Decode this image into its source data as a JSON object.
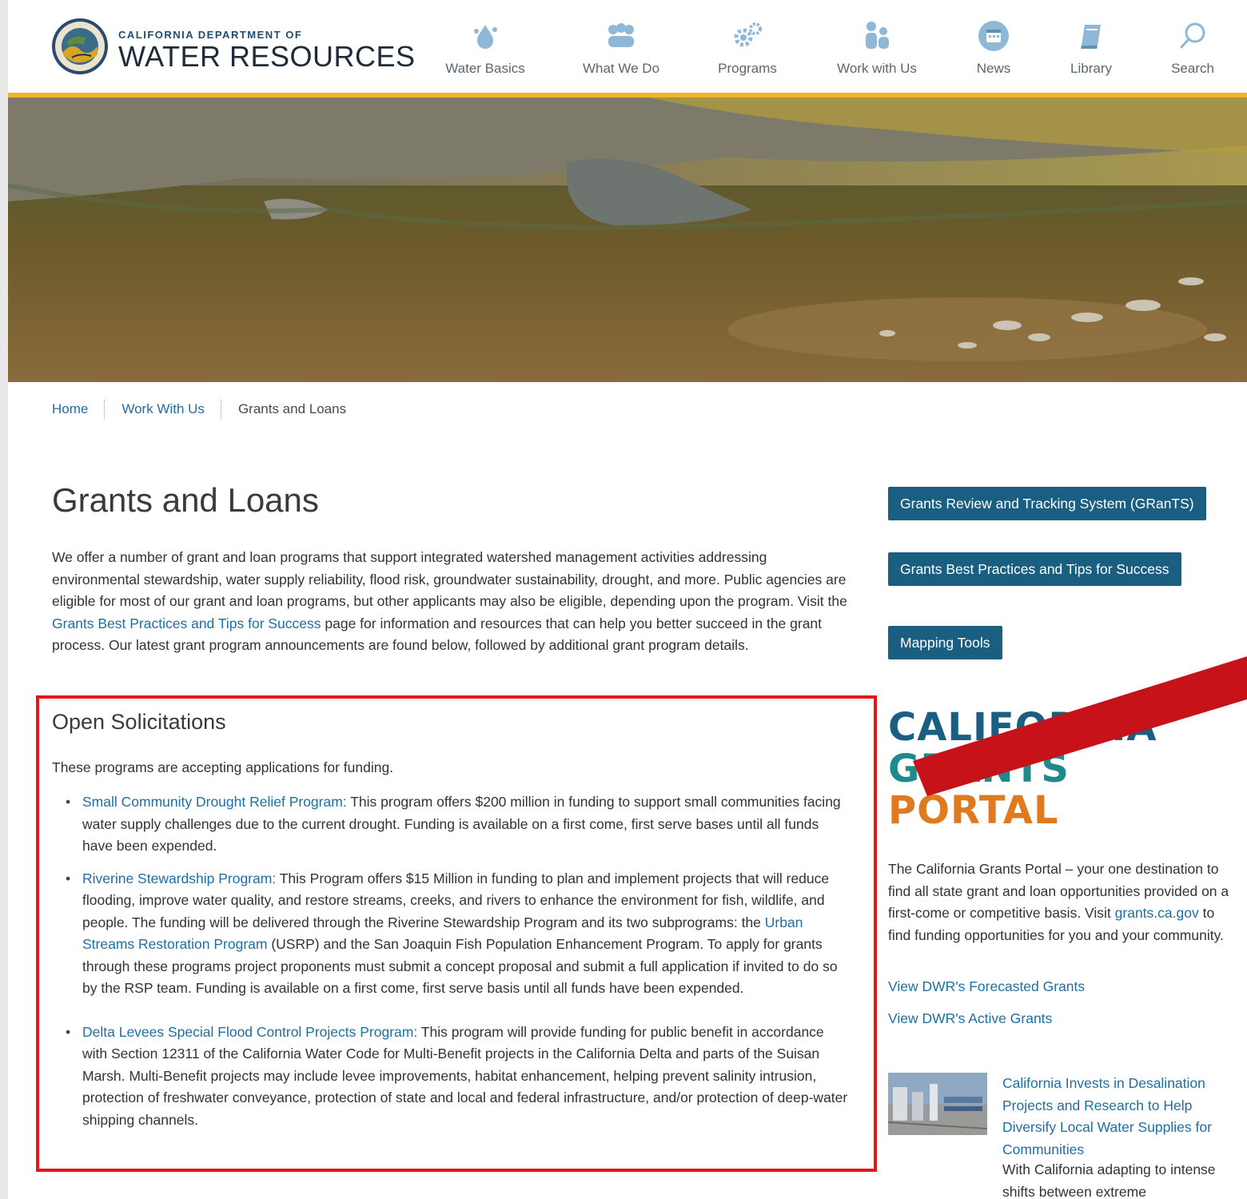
{
  "header": {
    "agency_top": "CALIFORNIA DEPARTMENT OF",
    "agency_main": "WATER RESOURCES",
    "nav": [
      {
        "label": "Water Basics",
        "icon": "water-drops-icon"
      },
      {
        "label": "What We Do",
        "icon": "people-group-icon"
      },
      {
        "label": "Programs",
        "icon": "gears-icon"
      },
      {
        "label": "Work with Us",
        "icon": "work-people-icon"
      },
      {
        "label": "News",
        "icon": "calendar-icon"
      },
      {
        "label": "Library",
        "icon": "book-icon"
      },
      {
        "label": "Search",
        "icon": "search-icon"
      }
    ]
  },
  "breadcrumb": {
    "home": "Home",
    "parent": "Work With Us",
    "current": "Grants and Loans"
  },
  "main": {
    "title": "Grants and Loans",
    "intro_part1": "We offer a number of grant and loan programs that support integrated watershed management activities addressing environmental stewardship, water supply reliability, flood risk, groundwater sustainability, drought, and more. Public agencies are eligible for most of our grant and loan programs, but other applicants may also be eligible, depending upon the program.  Visit the ",
    "intro_link": "Grants Best Practices and Tips for Success",
    "intro_part2": " page for information and resources that can help you better succeed in the grant process. Our latest grant program announcements are found below, followed by additional grant program details.",
    "open_solicitations": {
      "title": "Open Solicitations",
      "subtitle": "These programs are accepting applications for funding.",
      "item1_link": "Small Community Drought Relief Program:",
      "item1_text": " This program offers $200 million in funding to support small communities facing water supply challenges due to the current drought. Funding is available on a first come, first serve bases until all funds have been expended.",
      "item2_link": "Riverine Stewardship Program:",
      "item2_text_a": " This Program offers $15 Million in funding to plan and implement projects that will reduce flooding, improve water quality, and restore streams, creeks, and rivers to enhance the environment for fish, wildlife, and people. The funding will be delivered through the Riverine Stewardship Program and its two subprograms: the ",
      "item2_link2": "Urban Streams Restoration Program",
      "item2_text_b": " (USRP) and the San Joaquin Fish Population Enhancement Program. To apply for grants through these programs project proponents must submit a concept proposal and submit a full application if invited to do so by the RSP team. Funding is available on a first come, first serve basis until all funds have been expended.",
      "item3_link": "Delta Levees Special Flood Control Projects Program:",
      "item3_text": " This program will provide funding for public benefit in accordance with Section 12311 of the California Water Code for Multi-Benefit projects in the California Delta and parts of the Suisan Marsh.  Multi-Benefit projects may include levee improvements, habitat enhancement, helping prevent salinity intrusion, protection of freshwater conveyance, protection of state and local and federal infrastructure, and/or protection of deep-water shipping channels."
    }
  },
  "sidebar": {
    "btn_grants_tracking": "Grants Review and Tracking System (GRanTS)",
    "btn_best_practices": "Grants Best Practices and Tips for Success",
    "btn_mapping": "Mapping Tools",
    "portal_line1": "CALIFORNIA",
    "portal_line2": "GRANTS",
    "portal_line3": "PORTAL",
    "portal_text_a": "The California Grants Portal – your one destination to find all state grant and loan opportunities provided on a first-come or competitive basis. Visit ",
    "portal_link": "grants.ca.gov",
    "portal_text_b": " to find funding opportunities for you and your community.",
    "forecasted_link": "View DWR's Forecasted Grants",
    "active_link": "View DWR's Active Grants",
    "news_title": "California Invests in Desalination Projects and Research to Help Diversify Local Water Supplies for Communities",
    "news_summary": "With California adapting to intense shifts between extreme"
  },
  "colors": {
    "accent_gold": "#f0b429",
    "button_blue": "#1a5e82",
    "link_blue": "#1f6fa3",
    "highlight_red": "#e8141b",
    "arrow_red": "#c8121a"
  }
}
